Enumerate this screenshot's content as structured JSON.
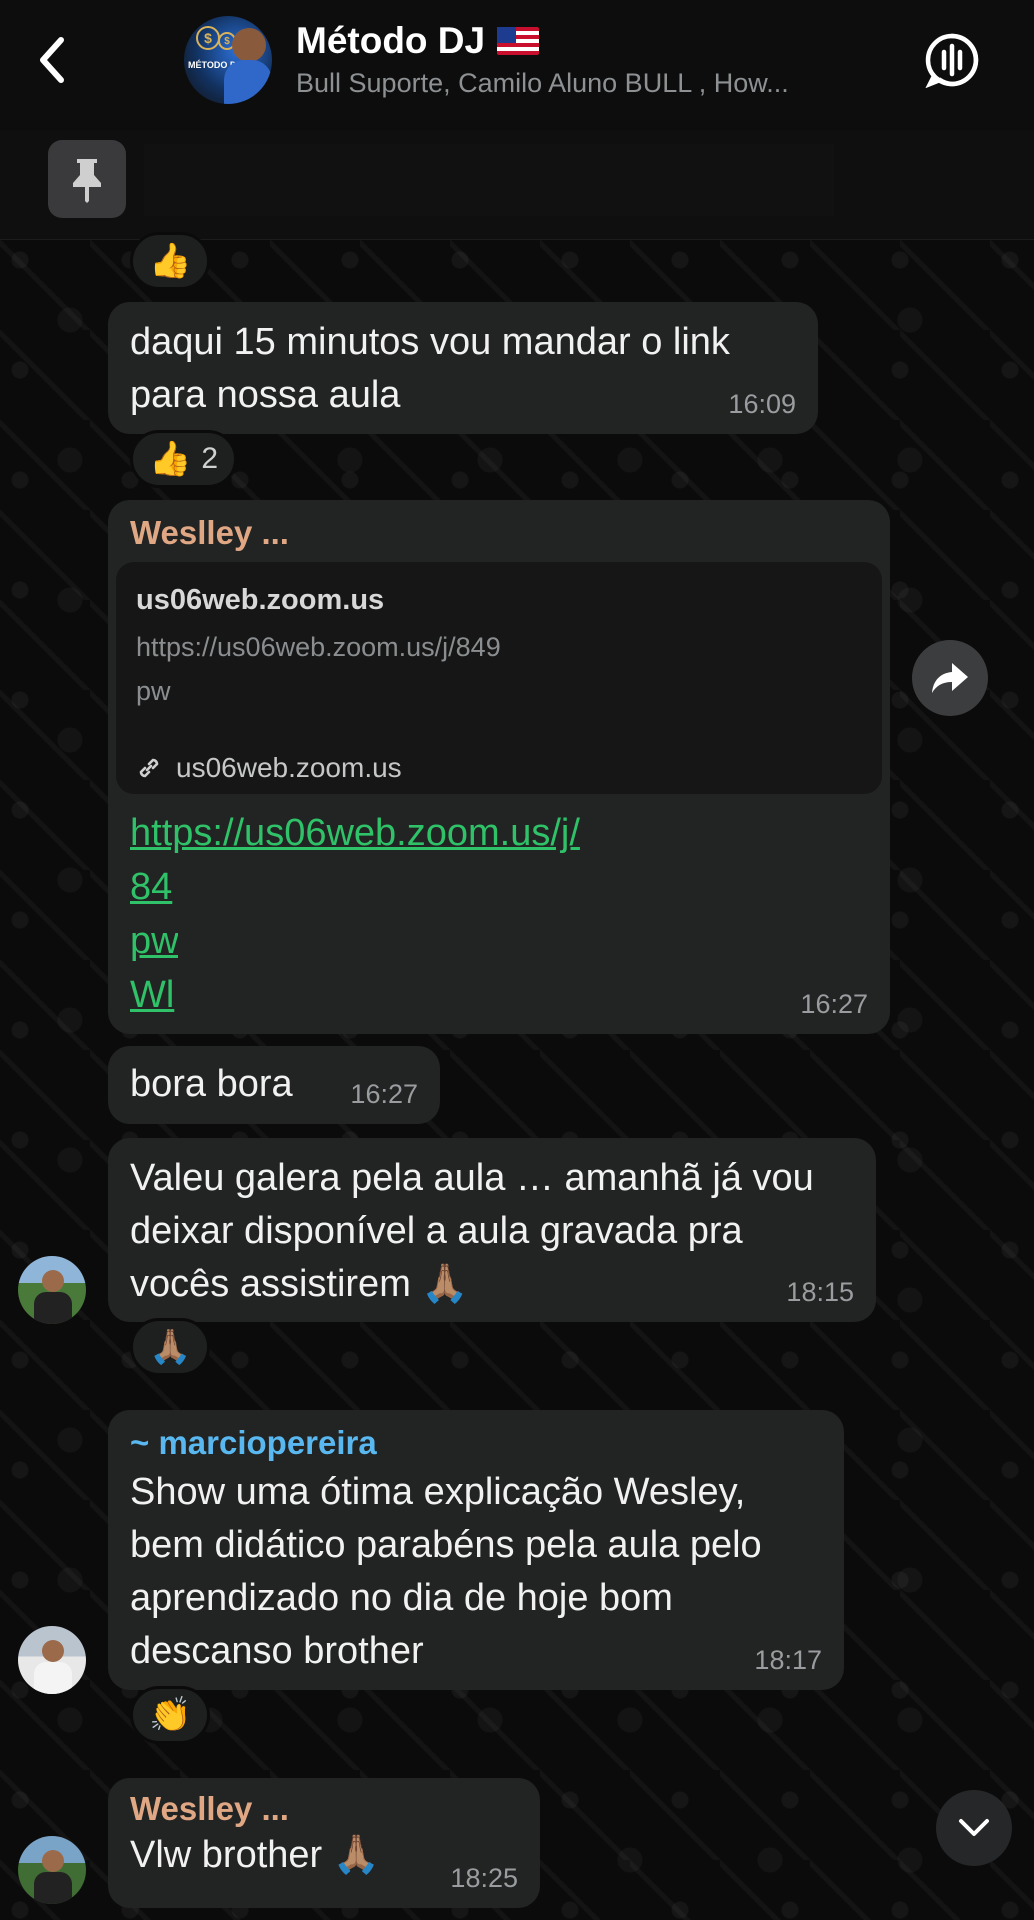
{
  "header": {
    "title": "Método DJ",
    "subtitle": "Bull Suporte, Camilo Aluno BULL , How...",
    "avatar_text": "MÉTODO DJ"
  },
  "messages": [
    {
      "text_line1": "daqui 15 minutos vou mandar  o link",
      "text_line2": "para nossa aula",
      "time": "16:09",
      "reaction_emoji": "👍",
      "reaction_count": "2"
    },
    {
      "sender": "Weslley ...",
      "link_preview": {
        "domain": "us06web.zoom.us",
        "url": "https://us06web.zoom.us/j/849",
        "extra": "pw",
        "footer": "us06web.zoom.us"
      },
      "link_lines": [
        "https://us06web.zoom.us/j/",
        "84",
        "pw",
        "Wl"
      ],
      "time": "16:27"
    },
    {
      "text": "bora bora",
      "time": "16:27"
    },
    {
      "text_line1": "Valeu galera pela aula … amanhã já vou",
      "text_line2": "deixar disponível a aula gravada pra",
      "text_line3": "vocês assistirem 🙏🏽",
      "time": "18:15",
      "reaction_emoji": "🙏🏽"
    },
    {
      "sender": "~ marciopereira",
      "text_line1": "Show uma ótima explicação Wesley,",
      "text_line2": "bem didático parabéns pela aula pelo",
      "text_line3": "aprendizado no dia de hoje bom",
      "text_line4": "descanso brother",
      "time": "18:17",
      "reaction_emoji": "👏"
    },
    {
      "sender": "Weslley ...",
      "text": "Vlw brother 🙏🏽",
      "time": "18:25"
    }
  ],
  "top_reaction_emoji": "👍"
}
